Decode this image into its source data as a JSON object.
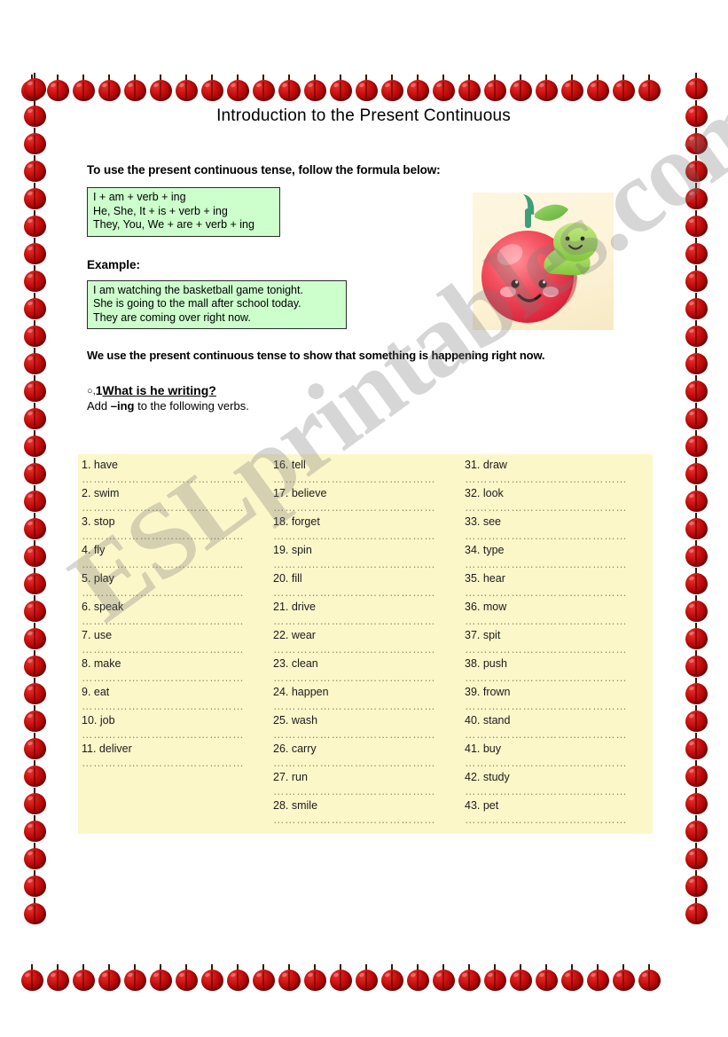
{
  "page": {
    "title": "Introduction to the Present Continuous",
    "watermark": "ESLprintables.com"
  },
  "intro": {
    "text": "To use the present continuous tense, follow the formula below:"
  },
  "formula_box": {
    "lines": [
      "I + am + verb + ing",
      "He, She, It + is + verb + ing",
      "They, You, We + are + verb + ing"
    ]
  },
  "example": {
    "label": "Example:",
    "lines": [
      "I am watching the basketball game tonight.",
      "She is going to the mall after school today.",
      "They are coming over right now."
    ]
  },
  "statement": {
    "text": "We use the present continuous tense to show that something is happening right now."
  },
  "question": {
    "marker": "○,",
    "number": "1",
    "text": "What is he writing?",
    "instruction_prefix": "Add ",
    "instruction_bold": "–ing",
    "instruction_suffix": " to the following verbs."
  },
  "clipart": {
    "name": "apple-with-worm-illustration",
    "background": "#fdf3d8",
    "apple_color": "#ef4a5a",
    "worm_color": "#8cd24a"
  },
  "border": {
    "name": "apple-bead-border",
    "apple_color": "#c00b0b",
    "top_count": 25,
    "side_count": 31
  },
  "exercise": {
    "background": "#fcf7c9",
    "dot_leader": "……………………………………",
    "columns": [
      {
        "items": [
          {
            "number": "1.",
            "verb": "have"
          },
          {
            "number": "2.",
            "verb": "swim"
          },
          {
            "number": "3.",
            "verb": "stop"
          },
          {
            "number": "4.",
            "verb": "fly"
          },
          {
            "number": "5.",
            "verb": "play"
          },
          {
            "number": "6.",
            "verb": "speak"
          },
          {
            "number": "7.",
            "verb": "use"
          },
          {
            "number": "8.",
            "verb": "make"
          },
          {
            "number": "9.",
            "verb": "eat"
          },
          {
            "number": "10.",
            "verb": "job"
          },
          {
            "number": "11.",
            "verb": "deliver"
          }
        ]
      },
      {
        "items": [
          {
            "number": "16.",
            "verb": "tell"
          },
          {
            "number": "17.",
            "verb": "believe"
          },
          {
            "number": "18.",
            "verb": "forget"
          },
          {
            "number": "19.",
            "verb": "spin"
          },
          {
            "number": "20.",
            "verb": "fill"
          },
          {
            "number": "21.",
            "verb": "drive"
          },
          {
            "number": "22.",
            "verb": "wear"
          },
          {
            "number": "23.",
            "verb": "clean"
          },
          {
            "number": "24.",
            "verb": "happen"
          },
          {
            "number": "25.",
            "verb": "wash"
          },
          {
            "number": "26.",
            "verb": "carry"
          },
          {
            "number": "27.",
            "verb": "run"
          },
          {
            "number": "28.",
            "verb": "smile"
          }
        ]
      },
      {
        "items": [
          {
            "number": "31.",
            "verb": "draw"
          },
          {
            "number": "32.",
            "verb": "look"
          },
          {
            "number": "33.",
            "verb": "see"
          },
          {
            "number": "34.",
            "verb": "type"
          },
          {
            "number": "35.",
            "verb": "hear"
          },
          {
            "number": "36.",
            "verb": "mow"
          },
          {
            "number": "37.",
            "verb": "spit"
          },
          {
            "number": "38.",
            "verb": "push"
          },
          {
            "number": "39.",
            "verb": "frown"
          },
          {
            "number": "40.",
            "verb": "stand"
          },
          {
            "number": "41.",
            "verb": "buy"
          },
          {
            "number": "42.",
            "verb": "study"
          },
          {
            "number": "43.",
            "verb": "pet"
          }
        ]
      }
    ]
  }
}
